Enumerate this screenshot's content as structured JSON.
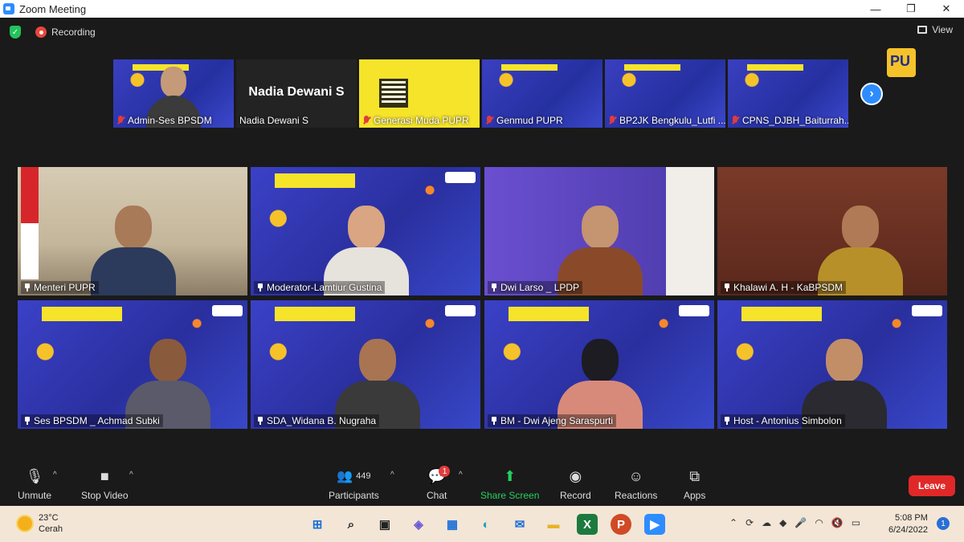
{
  "window": {
    "title": "Zoom Meeting",
    "minimize": "—",
    "maximize": "❐",
    "close": "✕"
  },
  "topbar": {
    "recording_label": "Recording",
    "view_label": "View"
  },
  "thumbnails": [
    {
      "name": "Admin-Ses BPSDM",
      "muted": true
    },
    {
      "name": "Nadia Dewani S",
      "display_text": "Nadia Dewani S",
      "muted": false
    },
    {
      "name": "Generasi Muda PUPR",
      "muted": true
    },
    {
      "name": "Genmud PUPR",
      "muted": true
    },
    {
      "name": "BP2JK Bengkulu_Lutfi ...",
      "muted": true
    },
    {
      "name": "CPNS_DJBH_Baiturrah...",
      "muted": true
    }
  ],
  "next_arrow": "›",
  "gallery": [
    {
      "name": "Menteri PUPR"
    },
    {
      "name": "Moderator-Lamtiur Gustina",
      "active": true
    },
    {
      "name": "Dwi Larso _ LPDP"
    },
    {
      "name": "Khalawi A. H - KaBPSDM"
    },
    {
      "name": "Ses BPSDM _ Achmad Subki"
    },
    {
      "name": "SDA_Widana B. Nugraha"
    },
    {
      "name": "BM - Dwi Ajeng Saraspurti"
    },
    {
      "name": "Host - Antonius Simbolon"
    }
  ],
  "controls": {
    "unmute": "Unmute",
    "stop_video": "Stop Video",
    "participants": "Participants",
    "participants_count": "449",
    "chat": "Chat",
    "chat_badge": "1",
    "share_screen": "Share Screen",
    "record": "Record",
    "reactions": "Reactions",
    "apps": "Apps",
    "leave": "Leave"
  },
  "taskbar": {
    "temperature": "23°C",
    "weather": "Cerah",
    "time": "5:08 PM",
    "date": "6/24/2022",
    "notification_count": "1"
  }
}
